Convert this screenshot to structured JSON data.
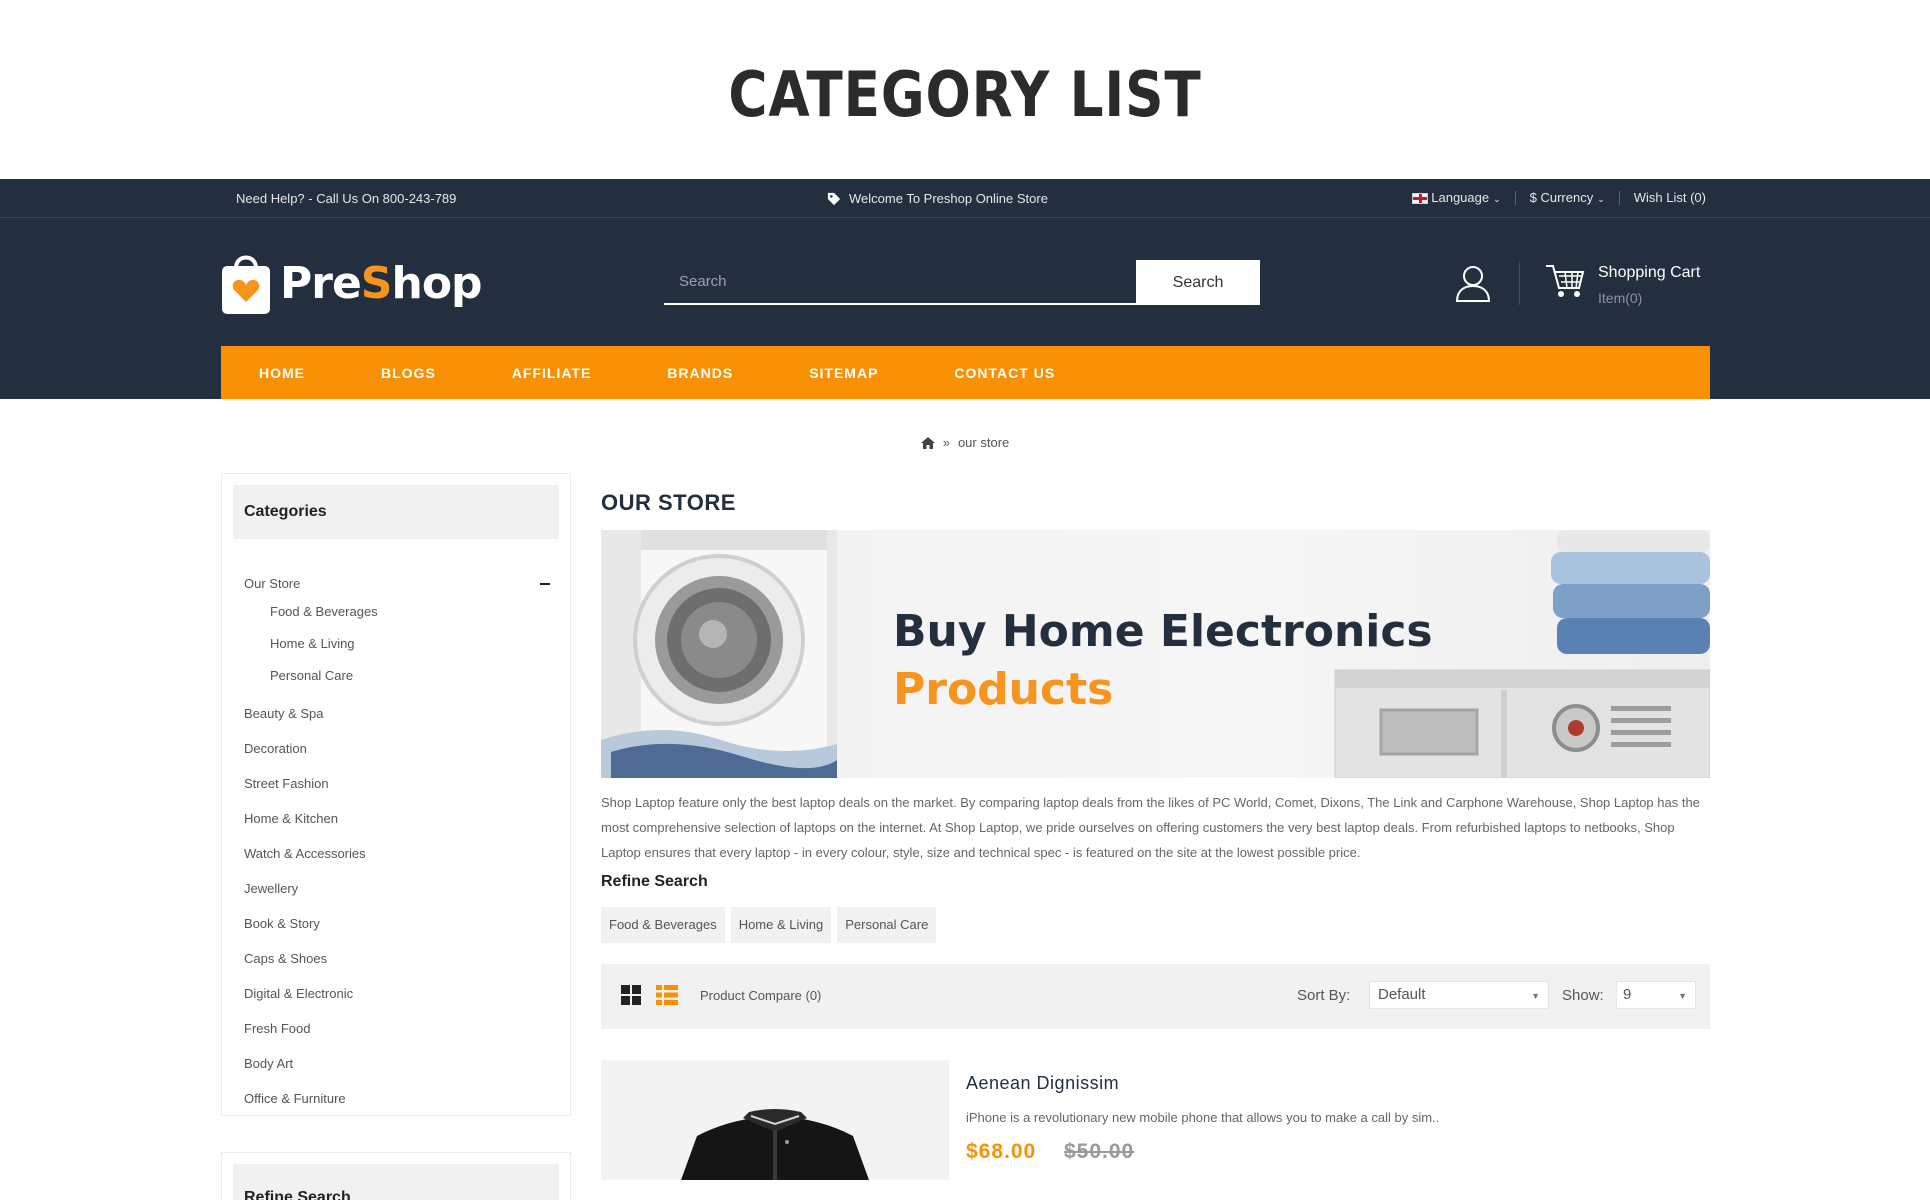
{
  "hero": {
    "title": "CATEGORY LIST"
  },
  "topbar": {
    "help": "Need Help? - Call Us On 800-243-789",
    "welcome": "Welcome To Preshop Online Store",
    "language": "Language",
    "currency": "$ Currency",
    "wishlist": "Wish List (0)"
  },
  "header": {
    "logo_pre": "Pre",
    "logo_s": "S",
    "logo_hop": "hop",
    "search_placeholder": "Search",
    "search_button": "Search",
    "cart_title": "Shopping Cart",
    "cart_count": "Item(0)"
  },
  "nav": {
    "items": [
      "HOME",
      "BLOGS",
      "AFFILIATE",
      "BRANDS",
      "SITEMAP",
      "CONTACT US"
    ]
  },
  "breadcrumb": {
    "separator": "»",
    "current": "our store"
  },
  "sidebar": {
    "title": "Categories",
    "active": "Our Store",
    "sub_items": [
      "Food & Beverages",
      "Home & Living",
      "Personal Care"
    ],
    "items": [
      "Beauty & Spa",
      "Decoration",
      "Street Fashion",
      "Home & Kitchen",
      "Watch & Accessories",
      "Jewellery",
      "Book & Story",
      "Caps & Shoes",
      "Digital & Electronic",
      "Fresh Food",
      "Body Art",
      "Office & Furniture"
    ],
    "refine_title": "Refine Search"
  },
  "main": {
    "title": "OUR STORE",
    "banner_line1": "Buy Home Electronics",
    "banner_line2": "Products",
    "description": "Shop Laptop feature only the best laptop deals on the market. By comparing laptop deals from the likes of PC World, Comet, Dixons, The Link and Carphone Warehouse, Shop Laptop has the most comprehensive selection of laptops on the internet. At Shop Laptop, we pride ourselves on offering customers the very best laptop deals. From refurbished laptops to netbooks, Shop Laptop ensures that every laptop - in every colour, style, size and technical spec - is featured on the site at the lowest possible price.",
    "refine_title": "Refine Search",
    "chips": [
      "Food & Beverages",
      "Home & Living",
      "Personal Care"
    ]
  },
  "toolbar": {
    "compare": "Product Compare (0)",
    "sort_label": "Sort By:",
    "sort_value": "Default",
    "show_label": "Show:",
    "show_value": "9"
  },
  "product": {
    "name": "Aenean Dignissim",
    "description": "iPhone is a revolutionary new mobile phone that allows you to make a call by sim..",
    "price": "$68.00",
    "old_price": "$50.00"
  },
  "colors": {
    "dark": "#232f3e",
    "accent": "#f99106"
  }
}
